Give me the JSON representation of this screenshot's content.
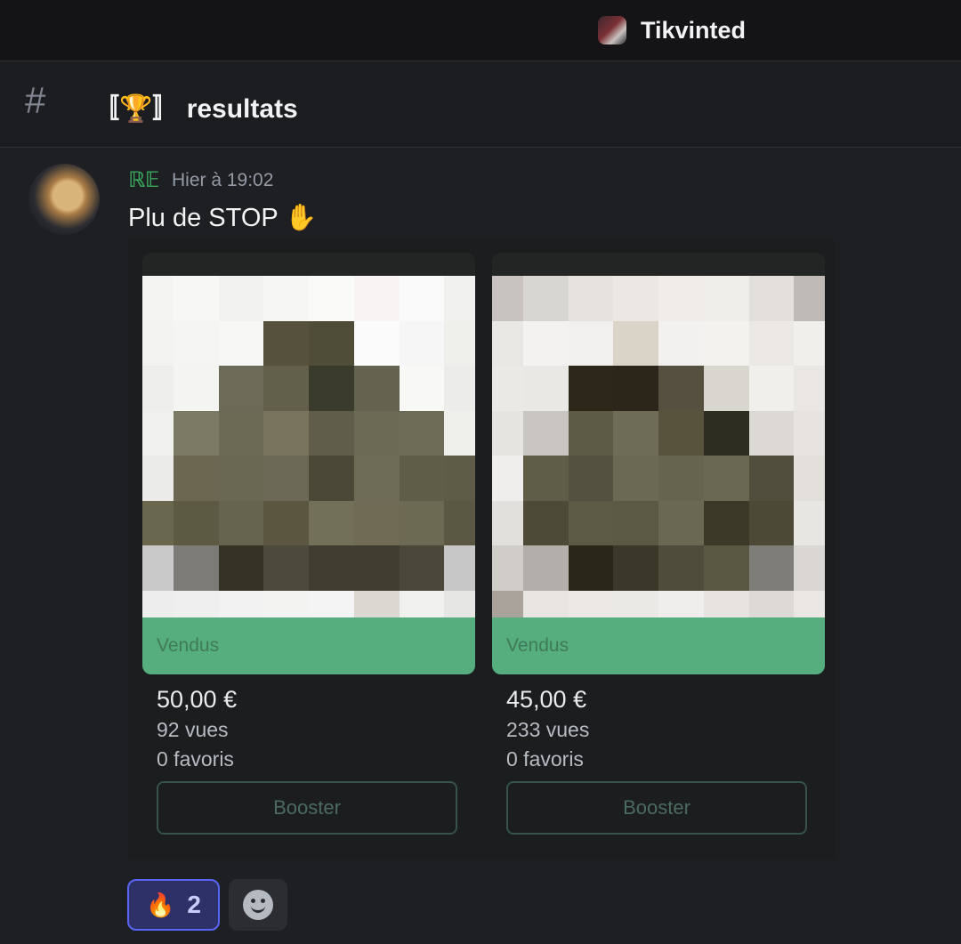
{
  "server": {
    "name": "Tikvinted",
    "icon": "server-avatar"
  },
  "channel": {
    "hash_icon": "#",
    "name": "〚🏆〛 resultats"
  },
  "message": {
    "author": "ℝ𝔼",
    "timestamp": "Hier à 19:02",
    "text": "Plu de STOP ✋",
    "avatar": "lion-cub-avatar",
    "colors": {
      "author": "#3ba55c"
    }
  },
  "embed": {
    "cards": [
      {
        "status": "Vendus",
        "price": "50,00 €",
        "views": "92 vues",
        "favorites": "0 favoris",
        "button": "Booster"
      },
      {
        "status": "Vendus",
        "price": "45,00 €",
        "views": "233 vues",
        "favorites": "0 favoris",
        "button": "Booster"
      }
    ]
  },
  "reactions": [
    {
      "emoji": "🔥",
      "count": "2"
    }
  ],
  "add_reaction_icon": "smile-icon"
}
